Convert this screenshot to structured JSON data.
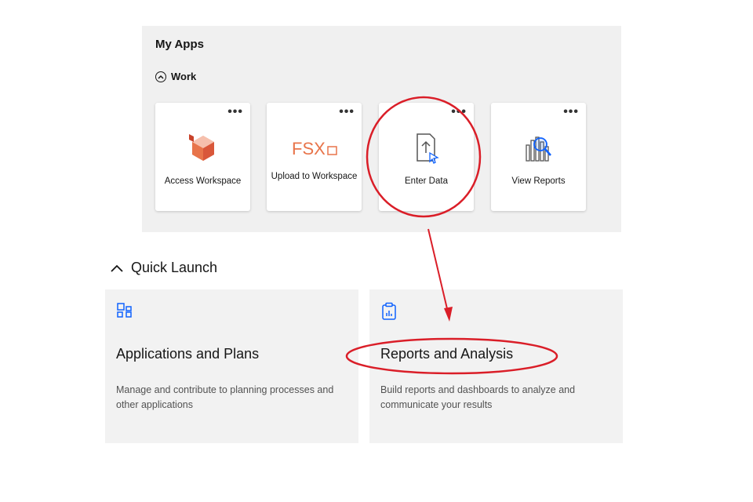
{
  "my_apps": {
    "title": "My Apps",
    "group_label": "Work",
    "tiles": [
      {
        "label": "Access Workspace",
        "icon": "cube-icon"
      },
      {
        "label": "Upload to Workspace",
        "icon": "fsx-upload-icon"
      },
      {
        "label": "Enter Data",
        "icon": "document-upload-cursor-icon"
      },
      {
        "label": "View Reports",
        "icon": "report-magnifier-icon"
      }
    ],
    "overflow_label": "•••"
  },
  "quick_launch": {
    "title": "Quick Launch",
    "cards": [
      {
        "title": "Applications and Plans",
        "description": "Manage and contribute to planning processes and other applications",
        "icon": "apps-grid-icon"
      },
      {
        "title": "Reports and Analysis",
        "description": "Build reports and dashboards to analyze and communicate your results",
        "icon": "clipboard-report-icon"
      }
    ]
  },
  "colors": {
    "accent": "#0f62fe",
    "annotation": "#da1e28",
    "tile_orange": "#e8744a"
  },
  "fsx_text": "FSX"
}
